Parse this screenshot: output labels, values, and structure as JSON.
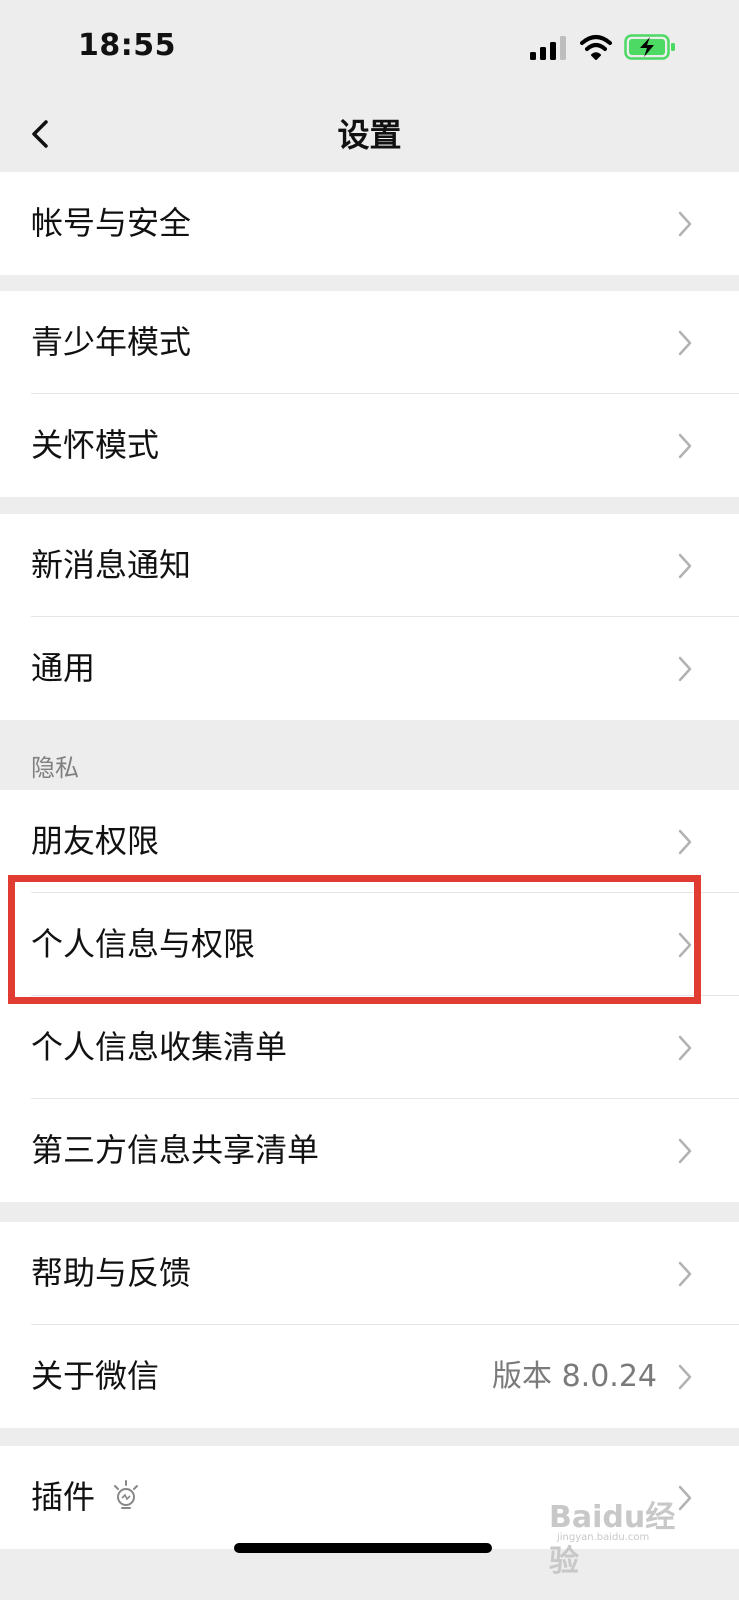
{
  "status_bar": {
    "time": "18:55"
  },
  "nav": {
    "title": "设置"
  },
  "groups": [
    {
      "items": [
        {
          "label": "帐号与安全"
        }
      ]
    },
    {
      "items": [
        {
          "label": "青少年模式"
        },
        {
          "label": "关怀模式"
        }
      ]
    },
    {
      "items": [
        {
          "label": "新消息通知"
        },
        {
          "label": "通用"
        }
      ]
    },
    {
      "header": "隐私",
      "items": [
        {
          "label": "朋友权限"
        },
        {
          "label": "个人信息与权限"
        },
        {
          "label": "个人信息收集清单"
        },
        {
          "label": "第三方信息共享清单"
        }
      ]
    },
    {
      "items": [
        {
          "label": "帮助与反馈"
        },
        {
          "label": "关于微信",
          "value": "版本 8.0.24"
        }
      ]
    },
    {
      "items": [
        {
          "label": "插件"
        }
      ]
    }
  ],
  "highlight": {
    "target": "个人信息与权限",
    "color": "#e03c31"
  },
  "watermark": {
    "text": "Baidu经验",
    "sub": "jingyan.baidu.com"
  },
  "icons": {
    "back": "chevron-left-icon",
    "row_arrow": "chevron-right-icon",
    "plugin": "lightbulb-icon"
  },
  "colors": {
    "background": "#ededed",
    "cell": "#ffffff",
    "battery_fill": "#4cd964"
  }
}
